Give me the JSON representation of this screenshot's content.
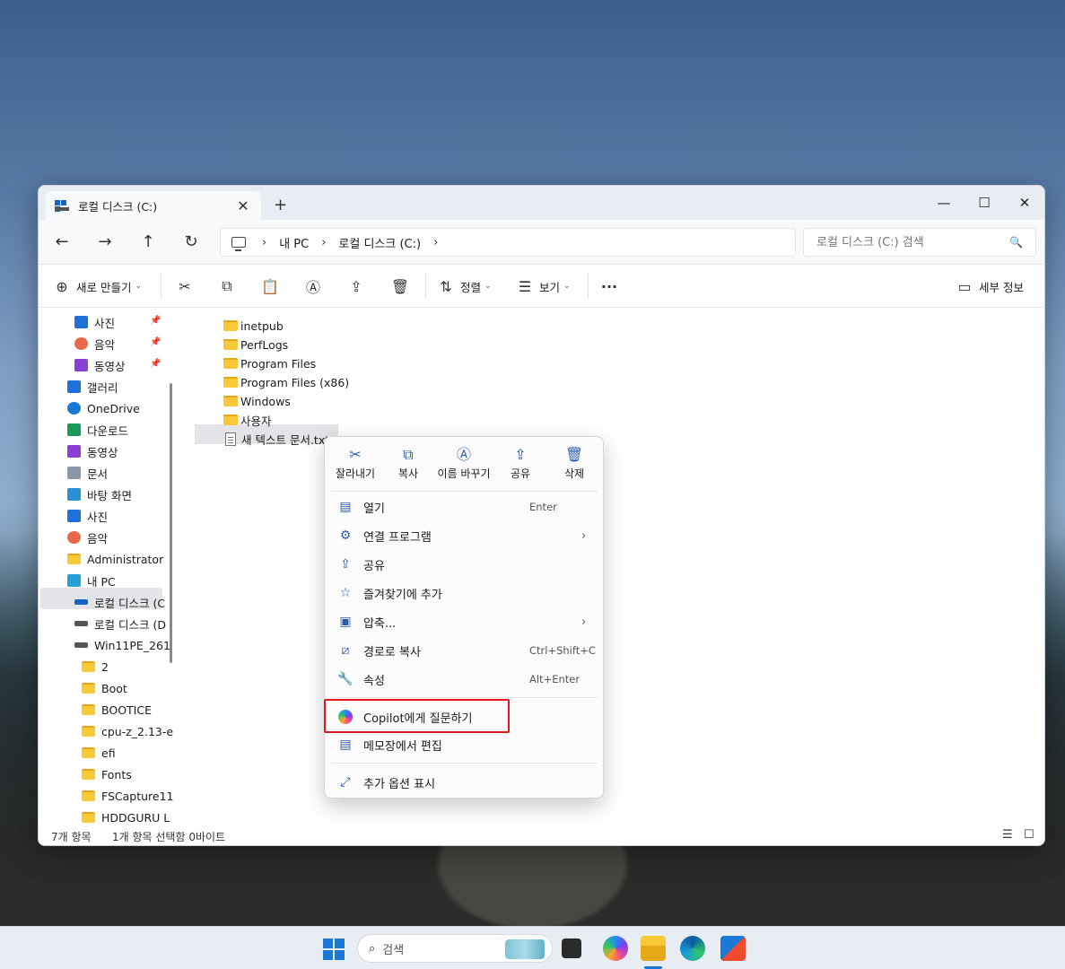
{
  "window": {
    "tab_title": "로컬 디스크 (C:)",
    "tab_close": "✕",
    "tab_add": "+",
    "minimize": "—",
    "maximize": "☐",
    "close": "✕"
  },
  "nav": {
    "back": "←",
    "forward": "→",
    "up": "↑",
    "refresh": "↻"
  },
  "breadcrumb": {
    "sep": "›",
    "items": [
      "내 PC",
      "로컬 디스크 (C:)"
    ]
  },
  "search": {
    "placeholder": "로컬 디스크 (C:) 검색",
    "icon": "🔍"
  },
  "toolbar": {
    "new_label": "새로 만들기",
    "sort_label": "정렬",
    "view_label": "보기",
    "more": "···",
    "details_label": "세부 정보",
    "caret": "⌄"
  },
  "sidebar": {
    "items": [
      {
        "label": "사진",
        "icon": "photos-icon",
        "color": "#1f6fd6"
      },
      {
        "label": "음악",
        "icon": "music-icon",
        "color": "#e8694a"
      },
      {
        "label": "동영상",
        "icon": "videos-icon",
        "color": "#8b3fd6"
      },
      {
        "label": "갤러리",
        "icon": "gallery-icon",
        "color": "#1f6fd6"
      },
      {
        "label": "OneDrive",
        "icon": "onedrive-icon",
        "color": "#1a78d6"
      },
      {
        "label": "다운로드",
        "icon": "downloads-icon",
        "color": "#1a9a5a"
      },
      {
        "label": "동영상",
        "icon": "videos-icon",
        "color": "#8b3fd6"
      },
      {
        "label": "문서",
        "icon": "documents-icon",
        "color": "#8a97a8"
      },
      {
        "label": "바탕 화면",
        "icon": "desktop-icon",
        "color": "#2b8fd6"
      },
      {
        "label": "사진",
        "icon": "photos-icon",
        "color": "#1f6fd6"
      },
      {
        "label": "음악",
        "icon": "music-icon",
        "color": "#e8694a"
      },
      {
        "label": "Administrator",
        "icon": "folder-icon",
        "color": "#f8c838"
      },
      {
        "label": "내 PC",
        "icon": "this-pc-icon",
        "color": "#2aa0d8"
      },
      {
        "label": "로컬 디스크 (C",
        "icon": "drive-icon",
        "color": "#1565c0"
      },
      {
        "label": "로컬 디스크 (D",
        "icon": "drive-icon",
        "color": "#555555"
      },
      {
        "label": "Win11PE_261",
        "icon": "drive-icon",
        "color": "#555555"
      },
      {
        "label": "2",
        "icon": "folder-icon",
        "color": "#f8c838"
      },
      {
        "label": "Boot",
        "icon": "folder-icon",
        "color": "#f8c838"
      },
      {
        "label": "BOOTICE",
        "icon": "folder-icon",
        "color": "#f8c838"
      },
      {
        "label": "cpu-z_2.13-e",
        "icon": "folder-icon",
        "color": "#f8c838"
      },
      {
        "label": "efi",
        "icon": "folder-icon",
        "color": "#f8c838"
      },
      {
        "label": "Fonts",
        "icon": "fonts-folder-icon",
        "color": "#f8c838"
      },
      {
        "label": "FSCapture11",
        "icon": "folder-icon",
        "color": "#f8c838"
      },
      {
        "label": "HDDGURU L",
        "icon": "folder-icon",
        "color": "#f8c838"
      }
    ],
    "pin": "📌"
  },
  "files": {
    "items": [
      {
        "name": "inetpub",
        "type": "folder"
      },
      {
        "name": "PerfLogs",
        "type": "folder"
      },
      {
        "name": "Program Files",
        "type": "folder"
      },
      {
        "name": "Program Files (x86)",
        "type": "folder"
      },
      {
        "name": "Windows",
        "type": "folder"
      },
      {
        "name": "사용자",
        "type": "folder"
      },
      {
        "name": "새 텍스트 문서.txt",
        "type": "text"
      }
    ]
  },
  "status": {
    "count": "7개 항목",
    "selection": "1개 항목 선택함 0바이트"
  },
  "context_menu": {
    "quick_actions": [
      {
        "label": "잘라내기",
        "icon": "cut-icon",
        "glyph": "✂"
      },
      {
        "label": "복사",
        "icon": "copy-icon",
        "glyph": "⧉"
      },
      {
        "label": "이름 바꾸기",
        "icon": "rename-icon",
        "glyph": "Ⓐ"
      },
      {
        "label": "공유",
        "icon": "share-icon",
        "glyph": "⇪"
      },
      {
        "label": "삭제",
        "icon": "delete-icon",
        "glyph": "🗑"
      }
    ],
    "items": [
      {
        "label": "열기",
        "shortcut": "Enter",
        "icon": "open-icon",
        "glyph": "▤"
      },
      {
        "label": "연결 프로그램",
        "arrow": "›",
        "icon": "open-with-icon",
        "glyph": "⚙"
      },
      {
        "label": "공유",
        "icon": "share-icon",
        "glyph": "⇪"
      },
      {
        "label": "즐겨찾기에 추가",
        "icon": "star-icon",
        "glyph": "☆"
      },
      {
        "label": "압축...",
        "arrow": "›",
        "icon": "compress-icon",
        "glyph": "▣"
      },
      {
        "label": "경로로 복사",
        "shortcut": "Ctrl+Shift+C",
        "icon": "copy-path-icon",
        "glyph": "⧄"
      },
      {
        "label": "속성",
        "shortcut": "Alt+Enter",
        "icon": "wrench-icon",
        "glyph": "🔧"
      }
    ],
    "copilot_label": "Copilot에게 질문하기",
    "notepad_label": "메모장에서 편집",
    "more_options_label": "추가 옵션 표시"
  },
  "taskbar": {
    "search_label": "검색"
  }
}
